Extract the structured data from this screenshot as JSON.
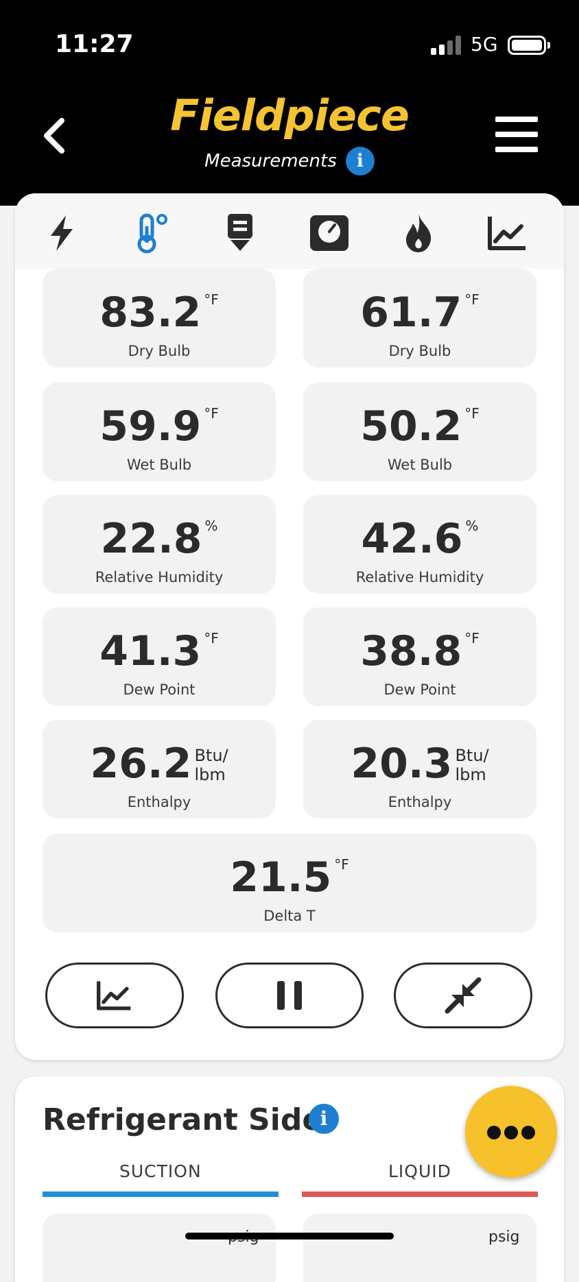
{
  "status": {
    "time": "11:27",
    "network": "5G"
  },
  "header": {
    "logo": "Fieldpiece",
    "subtitle": "Measurements",
    "info": "i"
  },
  "tabs": [
    {
      "icon": "lightning-icon"
    },
    {
      "icon": "thermometer-icon",
      "active": true
    },
    {
      "icon": "download-meter-icon"
    },
    {
      "icon": "gauge-icon"
    },
    {
      "icon": "flame-icon"
    },
    {
      "icon": "chart-icon"
    }
  ],
  "measurements": {
    "left": [
      {
        "value": "83.2",
        "unit": "°F",
        "label": "Dry Bulb"
      },
      {
        "value": "59.9",
        "unit": "°F",
        "label": "Wet Bulb"
      },
      {
        "value": "22.8",
        "unit": "%",
        "label": "Relative Humidity"
      },
      {
        "value": "41.3",
        "unit": "°F",
        "label": "Dew Point"
      },
      {
        "value": "26.2",
        "unit1": "Btu/",
        "unit2": "lbm",
        "label": "Enthalpy"
      }
    ],
    "right": [
      {
        "value": "61.7",
        "unit": "°F",
        "label": "Dry Bulb"
      },
      {
        "value": "50.2",
        "unit": "°F",
        "label": "Wet Bulb"
      },
      {
        "value": "42.6",
        "unit": "%",
        "label": "Relative Humidity"
      },
      {
        "value": "38.8",
        "unit": "°F",
        "label": "Dew Point"
      },
      {
        "value": "20.3",
        "unit1": "Btu/",
        "unit2": "lbm",
        "label": "Enthalpy"
      }
    ],
    "delta": {
      "value": "21.5",
      "unit": "°F",
      "label": "Delta T"
    }
  },
  "refrigerant": {
    "title": "Refrigerant Side",
    "info": "i",
    "suction": {
      "label": "SUCTION",
      "unit": "psig",
      "color": "#1f8fd6"
    },
    "liquid": {
      "label": "LIQUID",
      "unit": "psig",
      "color": "#e05555"
    }
  },
  "colors": {
    "accent": "#f5c332",
    "info": "#1e7fd0",
    "fab": "#f7c12b"
  }
}
